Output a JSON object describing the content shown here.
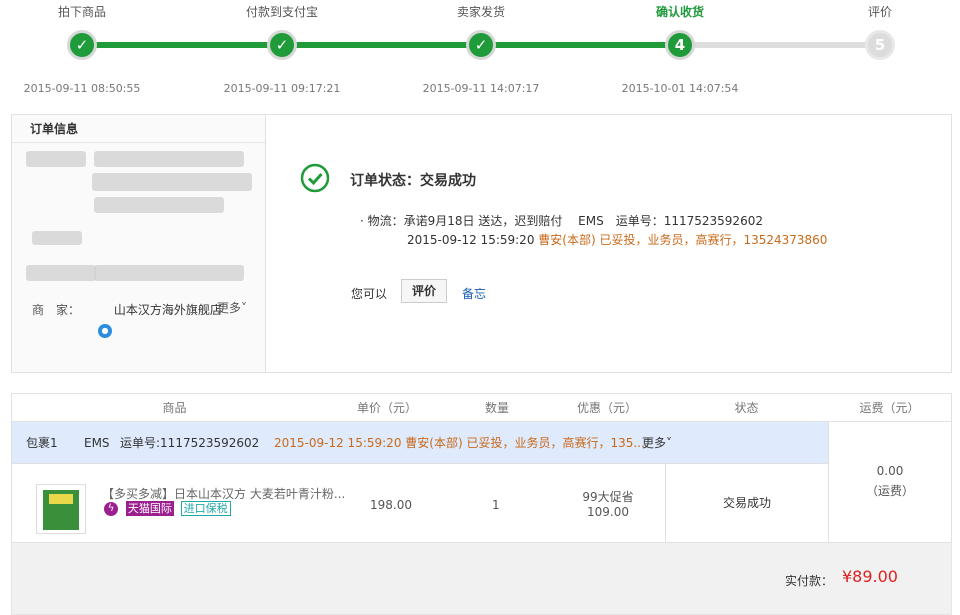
{
  "steps": [
    {
      "label": "拍下商品",
      "mark": "✓",
      "time": "2015-09-11 08:50:55"
    },
    {
      "label": "付款到支付宝",
      "mark": "✓",
      "time": "2015-09-11 09:17:21"
    },
    {
      "label": "卖家发货",
      "mark": "✓",
      "time": "2015-09-11 14:07:17"
    },
    {
      "label": "确认收货",
      "mark": "4",
      "time": "2015-10-01 14:07:54"
    },
    {
      "label": "评价",
      "mark": "5",
      "time": ""
    }
  ],
  "order_info": {
    "heading": "订单信息",
    "merchant_label": "商　家：",
    "merchant_name": "山本汉方海外旗舰店",
    "more": "更多˅"
  },
  "status": {
    "text": "订单状态：交易成功",
    "logistics_line1": "· 物流：承诺9月18日 送达，迟到赔付　 EMS　运单号：1117523592602",
    "logistics_date": "2015-09-12 15:59:20",
    "logistics_detail": "曹安(本部) 已妥投，业务员，高赛行，13524373860",
    "you_can": "您可以",
    "review_button": "评价",
    "memo_link": "备忘"
  },
  "table": {
    "headers": [
      "商品",
      "单价（元）",
      "数量",
      "优惠（元）",
      "状态",
      "运费（元）"
    ],
    "package": {
      "name": "包裹1",
      "carrier": "EMS",
      "tracking": "运单号:1117523592602",
      "update": "2015-09-12 15:59:20  曹安(本部) 已妥投，业务员，高赛行，135...",
      "more": "更多˅"
    },
    "item": {
      "title": "【多买多减】日本山本汉方 大麦若叶青汁粉...",
      "badge_tmall": "天猫国际",
      "badge_import": "进口保税",
      "price": "198.00",
      "qty": "1",
      "discount_label": "99大促省",
      "discount_value": "109.00",
      "state": "交易成功"
    },
    "shipping_value": "0.00",
    "shipping_label": "（运费）"
  },
  "total": {
    "label": "实付款：",
    "value": "¥89.00"
  },
  "colors": {
    "accent": "#1f9b3a",
    "orange": "#c96a1a",
    "price_red": "#dd2222",
    "link": "#1a5fb4"
  }
}
